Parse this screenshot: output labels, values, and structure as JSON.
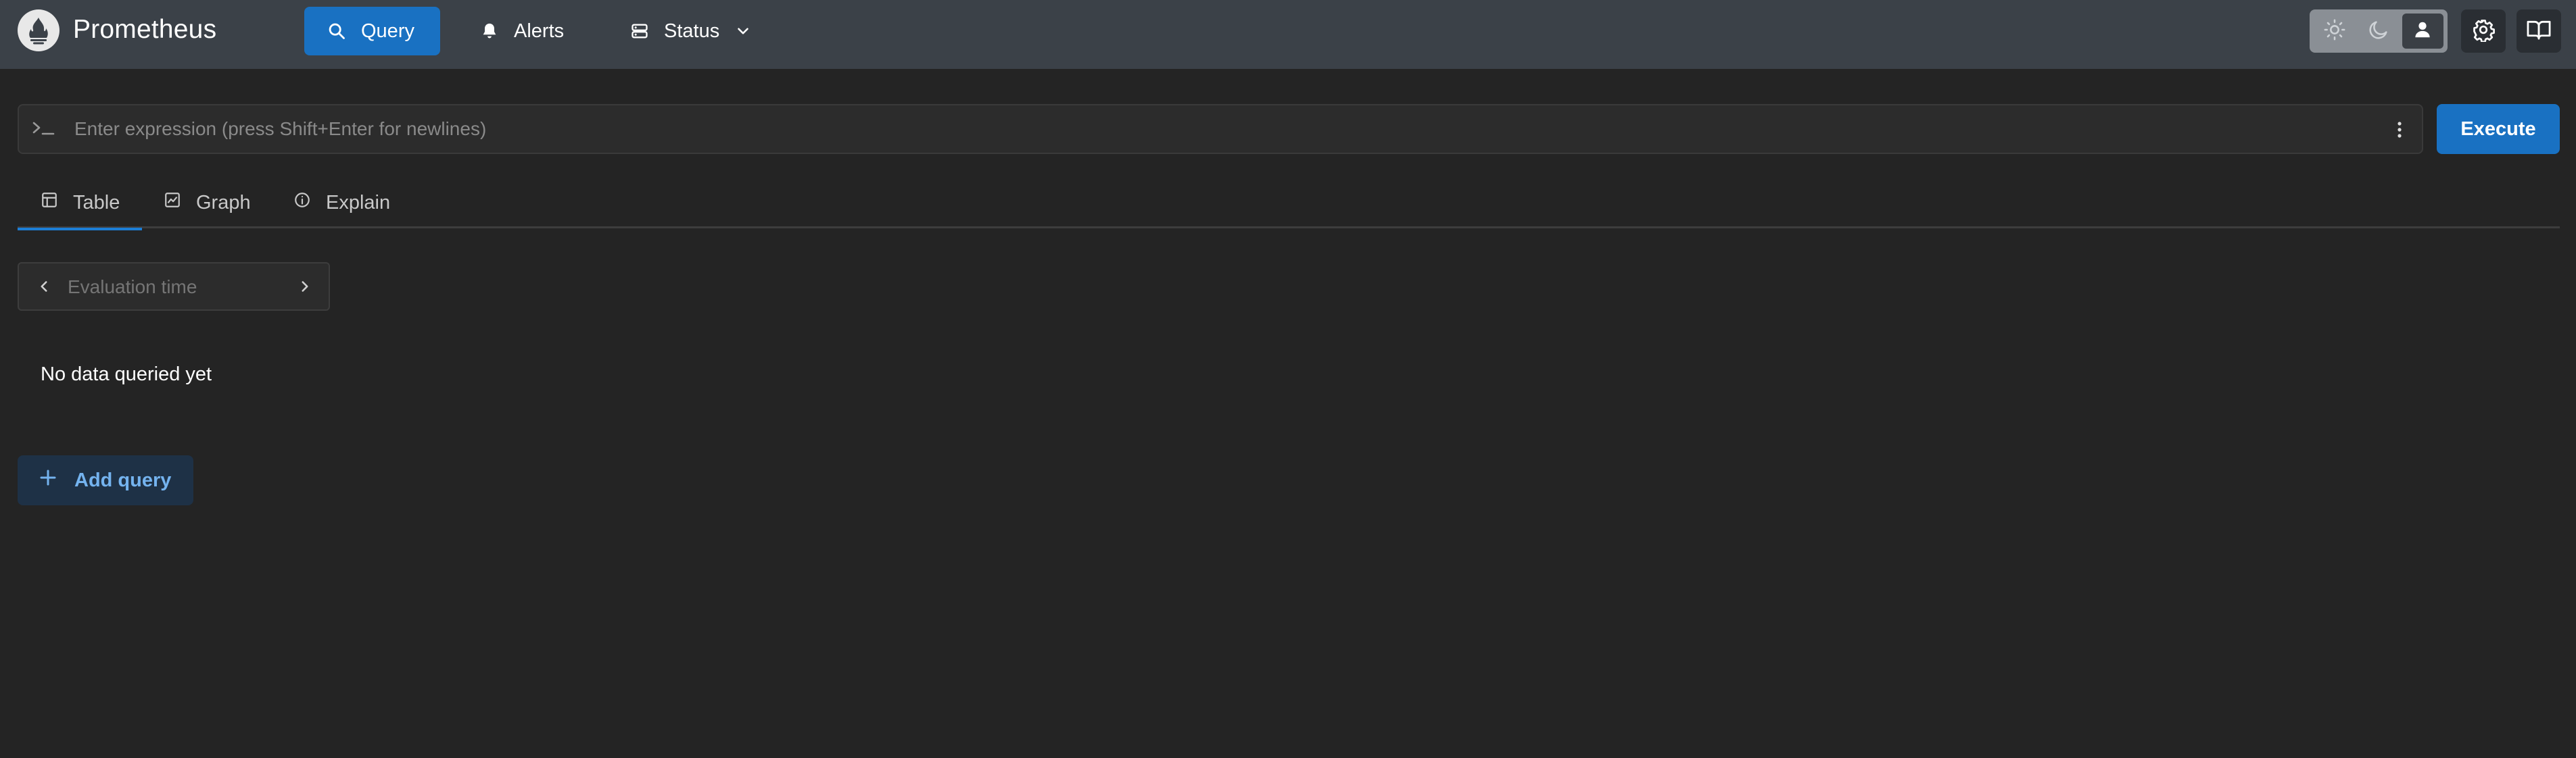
{
  "app": {
    "brand": "Prometheus"
  },
  "nav": {
    "query": {
      "label": "Query",
      "icon": "search-icon"
    },
    "alerts": {
      "label": "Alerts",
      "icon": "bell-icon"
    },
    "status": {
      "label": "Status",
      "icon": "server-icon"
    }
  },
  "header_actions": {
    "theme_options": [
      "light",
      "dark",
      "auto"
    ],
    "theme_selected": "auto",
    "settings_icon": "gear-icon",
    "docs_icon": "book-icon"
  },
  "expression": {
    "placeholder": "Enter expression (press Shift+Enter for newlines)",
    "value": "",
    "execute_label": "Execute"
  },
  "tabs": [
    {
      "label": "Table",
      "icon": "table-icon",
      "active": true
    },
    {
      "label": "Graph",
      "icon": "graph-icon",
      "active": false
    },
    {
      "label": "Explain",
      "icon": "info-icon",
      "active": false
    }
  ],
  "eval_time": {
    "placeholder": "Evaluation time"
  },
  "result": {
    "empty_text": "No data queried yet"
  },
  "add_query": {
    "label": "Add query"
  },
  "colors": {
    "header_bg": "#3b4148",
    "page_bg": "#242424",
    "accent": "#1971c2",
    "add_query_text": "#74b3ef"
  }
}
